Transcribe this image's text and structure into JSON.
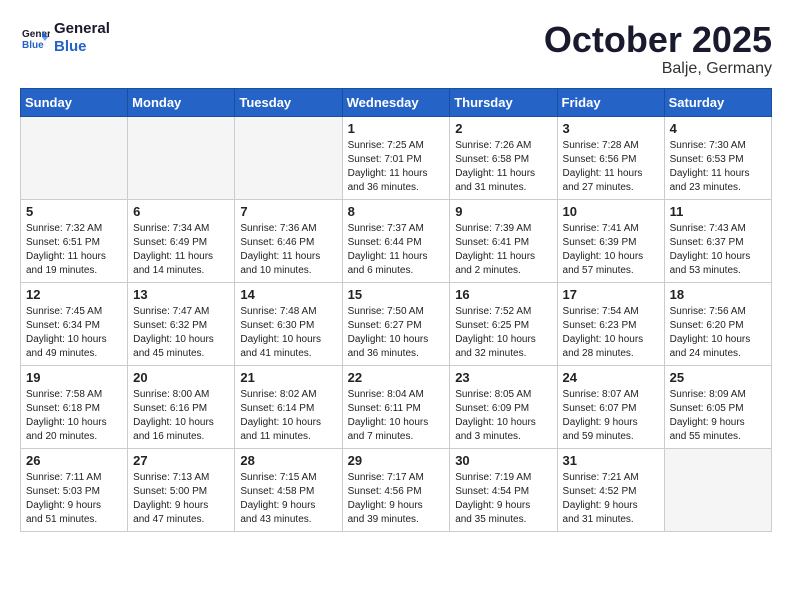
{
  "logo": {
    "general": "General",
    "blue": "Blue"
  },
  "header": {
    "month": "October 2025",
    "location": "Balje, Germany"
  },
  "weekdays": [
    "Sunday",
    "Monday",
    "Tuesday",
    "Wednesday",
    "Thursday",
    "Friday",
    "Saturday"
  ],
  "weeks": [
    [
      {
        "day": "",
        "info": ""
      },
      {
        "day": "",
        "info": ""
      },
      {
        "day": "",
        "info": ""
      },
      {
        "day": "1",
        "info": "Sunrise: 7:25 AM\nSunset: 7:01 PM\nDaylight: 11 hours\nand 36 minutes."
      },
      {
        "day": "2",
        "info": "Sunrise: 7:26 AM\nSunset: 6:58 PM\nDaylight: 11 hours\nand 31 minutes."
      },
      {
        "day": "3",
        "info": "Sunrise: 7:28 AM\nSunset: 6:56 PM\nDaylight: 11 hours\nand 27 minutes."
      },
      {
        "day": "4",
        "info": "Sunrise: 7:30 AM\nSunset: 6:53 PM\nDaylight: 11 hours\nand 23 minutes."
      }
    ],
    [
      {
        "day": "5",
        "info": "Sunrise: 7:32 AM\nSunset: 6:51 PM\nDaylight: 11 hours\nand 19 minutes."
      },
      {
        "day": "6",
        "info": "Sunrise: 7:34 AM\nSunset: 6:49 PM\nDaylight: 11 hours\nand 14 minutes."
      },
      {
        "day": "7",
        "info": "Sunrise: 7:36 AM\nSunset: 6:46 PM\nDaylight: 11 hours\nand 10 minutes."
      },
      {
        "day": "8",
        "info": "Sunrise: 7:37 AM\nSunset: 6:44 PM\nDaylight: 11 hours\nand 6 minutes."
      },
      {
        "day": "9",
        "info": "Sunrise: 7:39 AM\nSunset: 6:41 PM\nDaylight: 11 hours\nand 2 minutes."
      },
      {
        "day": "10",
        "info": "Sunrise: 7:41 AM\nSunset: 6:39 PM\nDaylight: 10 hours\nand 57 minutes."
      },
      {
        "day": "11",
        "info": "Sunrise: 7:43 AM\nSunset: 6:37 PM\nDaylight: 10 hours\nand 53 minutes."
      }
    ],
    [
      {
        "day": "12",
        "info": "Sunrise: 7:45 AM\nSunset: 6:34 PM\nDaylight: 10 hours\nand 49 minutes."
      },
      {
        "day": "13",
        "info": "Sunrise: 7:47 AM\nSunset: 6:32 PM\nDaylight: 10 hours\nand 45 minutes."
      },
      {
        "day": "14",
        "info": "Sunrise: 7:48 AM\nSunset: 6:30 PM\nDaylight: 10 hours\nand 41 minutes."
      },
      {
        "day": "15",
        "info": "Sunrise: 7:50 AM\nSunset: 6:27 PM\nDaylight: 10 hours\nand 36 minutes."
      },
      {
        "day": "16",
        "info": "Sunrise: 7:52 AM\nSunset: 6:25 PM\nDaylight: 10 hours\nand 32 minutes."
      },
      {
        "day": "17",
        "info": "Sunrise: 7:54 AM\nSunset: 6:23 PM\nDaylight: 10 hours\nand 28 minutes."
      },
      {
        "day": "18",
        "info": "Sunrise: 7:56 AM\nSunset: 6:20 PM\nDaylight: 10 hours\nand 24 minutes."
      }
    ],
    [
      {
        "day": "19",
        "info": "Sunrise: 7:58 AM\nSunset: 6:18 PM\nDaylight: 10 hours\nand 20 minutes."
      },
      {
        "day": "20",
        "info": "Sunrise: 8:00 AM\nSunset: 6:16 PM\nDaylight: 10 hours\nand 16 minutes."
      },
      {
        "day": "21",
        "info": "Sunrise: 8:02 AM\nSunset: 6:14 PM\nDaylight: 10 hours\nand 11 minutes."
      },
      {
        "day": "22",
        "info": "Sunrise: 8:04 AM\nSunset: 6:11 PM\nDaylight: 10 hours\nand 7 minutes."
      },
      {
        "day": "23",
        "info": "Sunrise: 8:05 AM\nSunset: 6:09 PM\nDaylight: 10 hours\nand 3 minutes."
      },
      {
        "day": "24",
        "info": "Sunrise: 8:07 AM\nSunset: 6:07 PM\nDaylight: 9 hours\nand 59 minutes."
      },
      {
        "day": "25",
        "info": "Sunrise: 8:09 AM\nSunset: 6:05 PM\nDaylight: 9 hours\nand 55 minutes."
      }
    ],
    [
      {
        "day": "26",
        "info": "Sunrise: 7:11 AM\nSunset: 5:03 PM\nDaylight: 9 hours\nand 51 minutes."
      },
      {
        "day": "27",
        "info": "Sunrise: 7:13 AM\nSunset: 5:00 PM\nDaylight: 9 hours\nand 47 minutes."
      },
      {
        "day": "28",
        "info": "Sunrise: 7:15 AM\nSunset: 4:58 PM\nDaylight: 9 hours\nand 43 minutes."
      },
      {
        "day": "29",
        "info": "Sunrise: 7:17 AM\nSunset: 4:56 PM\nDaylight: 9 hours\nand 39 minutes."
      },
      {
        "day": "30",
        "info": "Sunrise: 7:19 AM\nSunset: 4:54 PM\nDaylight: 9 hours\nand 35 minutes."
      },
      {
        "day": "31",
        "info": "Sunrise: 7:21 AM\nSunset: 4:52 PM\nDaylight: 9 hours\nand 31 minutes."
      },
      {
        "day": "",
        "info": ""
      }
    ]
  ]
}
